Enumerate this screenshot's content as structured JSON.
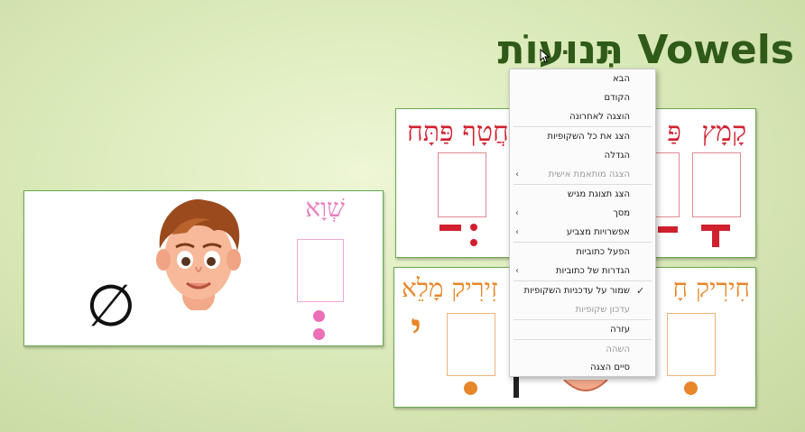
{
  "slide": {
    "title": "תְּנוּעוֹת  Vowels"
  },
  "shva_card": {
    "label": "שְׁוָא"
  },
  "top_card": {
    "labels": [
      "קָמָץ",
      "פַּ",
      "חֲטָף פַּתָּח"
    ]
  },
  "bottom_card": {
    "labels": [
      "חִירִיק חָ",
      "זִירִיק מָלֵא"
    ],
    "yod": "י"
  },
  "context_menu": {
    "items": [
      {
        "label": "הבא",
        "enabled": true
      },
      {
        "label": "הקודם",
        "enabled": true
      },
      {
        "label": "הוצגה לאחרונה",
        "enabled": true
      },
      {
        "label": "הצג את כל השקופיות",
        "enabled": true
      },
      {
        "label": "הגדלה",
        "enabled": true
      },
      {
        "label": "הצגה מותאמת אישית",
        "enabled": false,
        "submenu": true
      },
      {
        "label": "הצג תצוגת מגיש",
        "enabled": true
      },
      {
        "label": "מסך",
        "enabled": true,
        "submenu": true
      },
      {
        "label": "אפשרויות מצביע",
        "enabled": true,
        "submenu": true
      },
      {
        "label": "הפעל כתוביות",
        "enabled": true
      },
      {
        "label": "הגדרות של כתוביות",
        "enabled": true,
        "submenu": true
      },
      {
        "label": "שמור על עדכניות השקופיות",
        "enabled": true,
        "checked": true
      },
      {
        "label": "עדכון שקופיות",
        "enabled": false
      },
      {
        "label": "עזרה",
        "enabled": true
      },
      {
        "label": "השהה",
        "enabled": false
      },
      {
        "label": "סיים הצגה",
        "enabled": true
      }
    ]
  },
  "colors": {
    "title_green": "#2f5a18",
    "shva_pink": "#e87fc0",
    "qamats_red": "#d1202e",
    "hiriq_orange": "#e8862a",
    "card_border": "#6aa84f"
  }
}
